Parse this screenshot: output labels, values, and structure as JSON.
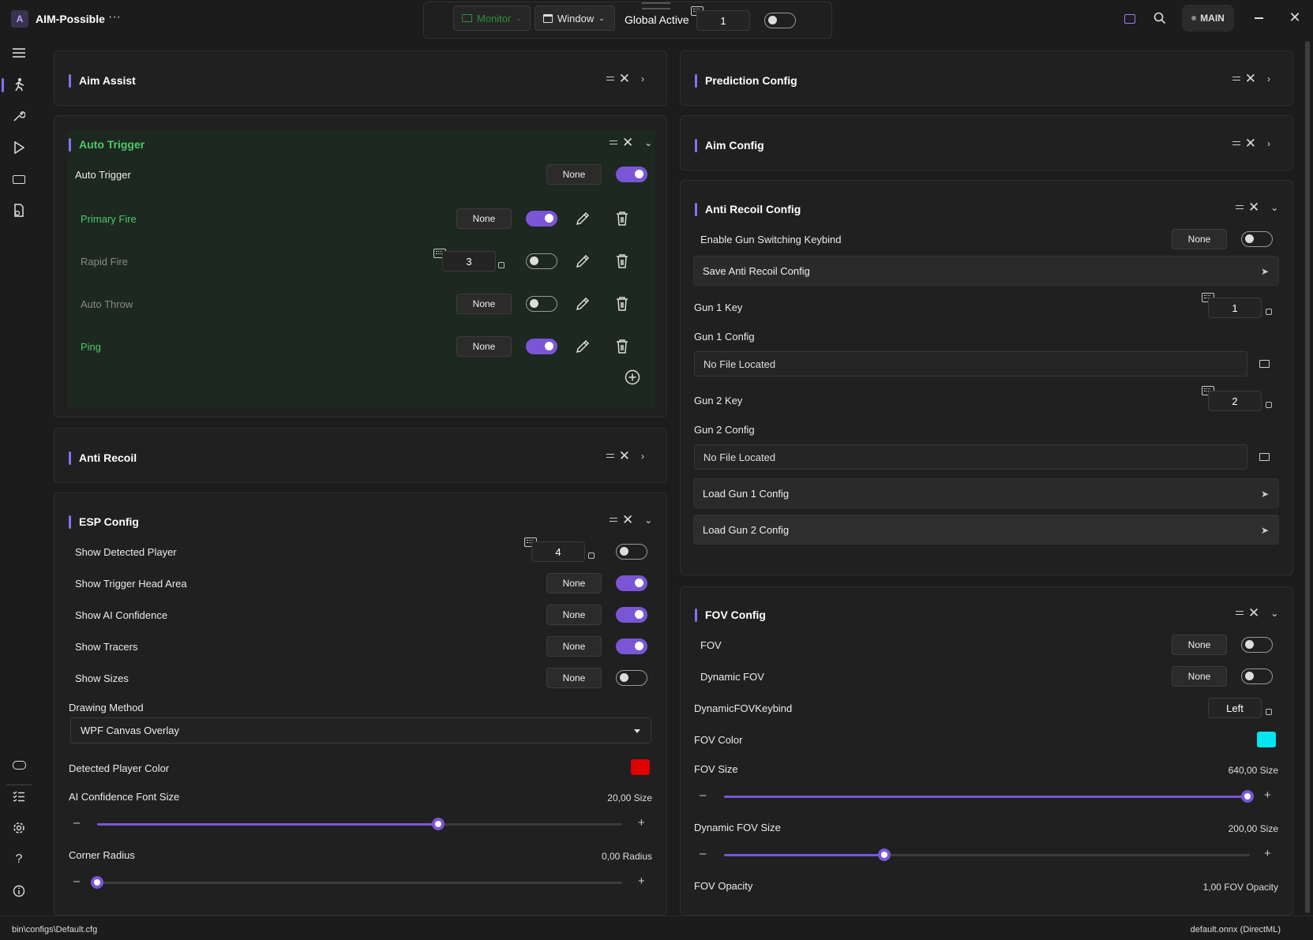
{
  "app": {
    "title": "AIM-Possible",
    "more": "···"
  },
  "topbar": {
    "monitor_label": "Monitor",
    "window_label": "Window",
    "global_active_label": "Global Active",
    "global_active_value": "1",
    "global_active_on": false,
    "main_label": "MAIN"
  },
  "panels": {
    "aim_assist": {
      "title": "Aim Assist"
    },
    "auto_trigger": {
      "title": "Auto Trigger",
      "main_row": {
        "label": "Auto Trigger",
        "key": "None",
        "on": true
      },
      "rows": [
        {
          "label": "Primary Fire",
          "key": "None",
          "on": true,
          "active": true
        },
        {
          "label": "Rapid Fire",
          "key": "3",
          "on": false,
          "active": false
        },
        {
          "label": "Auto Throw",
          "key": "None",
          "on": false,
          "active": false
        },
        {
          "label": "Ping",
          "key": "None",
          "on": true,
          "active": true
        }
      ]
    },
    "anti_recoil": {
      "title": "Anti Recoil"
    },
    "esp_config": {
      "title": "ESP Config",
      "rows": [
        {
          "label": "Show Detected Player",
          "key": "4",
          "on": false
        },
        {
          "label": "Show Trigger Head Area",
          "key": "None",
          "on": true
        },
        {
          "label": "Show AI Confidence",
          "key": "None",
          "on": true
        },
        {
          "label": "Show Tracers",
          "key": "None",
          "on": true
        },
        {
          "label": "Show Sizes",
          "key": "None",
          "on": false
        }
      ],
      "drawing_method_label": "Drawing Method",
      "drawing_method_value": "WPF Canvas Overlay",
      "detected_player_color_label": "Detected Player Color",
      "detected_player_color": "#e00000",
      "font_size_label": "AI Confidence Font Size",
      "font_size_value": "20,00 Size",
      "font_size_fraction": 0.65,
      "corner_radius_label": "Corner Radius",
      "corner_radius_value": "0,00 Radius",
      "corner_radius_fraction": 0.0,
      "minus": "–",
      "plus": "+"
    },
    "prediction_config": {
      "title": "Prediction Config"
    },
    "aim_config": {
      "title": "Aim Config"
    },
    "anti_recoil_config": {
      "title": "Anti Recoil Config",
      "gun_switch_label": "Enable Gun Switching Keybind",
      "gun_switch_key": "None",
      "gun_switch_on": false,
      "save_label": "Save Anti Recoil Config",
      "gun1_key_label": "Gun 1 Key",
      "gun1_key_value": "1",
      "gun1_config_label": "Gun 1 Config",
      "gun1_config_value": "No File Located",
      "gun2_key_label": "Gun 2 Key",
      "gun2_key_value": "2",
      "gun2_config_label": "Gun 2 Config",
      "gun2_config_value": "No File Located",
      "load1_label": "Load Gun 1 Config",
      "load2_label": "Load Gun 2 Config"
    },
    "fov_config": {
      "title": "FOV Config",
      "fov_label": "FOV",
      "fov_key": "None",
      "fov_on": false,
      "dyn_fov_label": "Dynamic FOV",
      "dyn_fov_key": "None",
      "dyn_fov_on": false,
      "dyn_keybind_label": "DynamicFOVKeybind",
      "dyn_keybind_value": "Left",
      "fov_color_label": "FOV Color",
      "fov_color": "#00e5f0",
      "fov_size_label": "FOV Size",
      "fov_size_value": "640,00 Size",
      "fov_size_fraction": 0.995,
      "dyn_fov_size_label": "Dynamic FOV Size",
      "dyn_fov_size_value": "200,00 Size",
      "dyn_fov_size_fraction": 0.305,
      "fov_opacity_label": "FOV Opacity",
      "fov_opacity_value": "1,00 FOV Opacity"
    }
  },
  "status": {
    "left": "bin\\configs\\Default.cfg",
    "right": "default.onnx (DirectML)"
  },
  "colors": {
    "accent": "#8a6ff0",
    "toggle_on": "#7a55d6",
    "active_green": "#4cc86a"
  }
}
